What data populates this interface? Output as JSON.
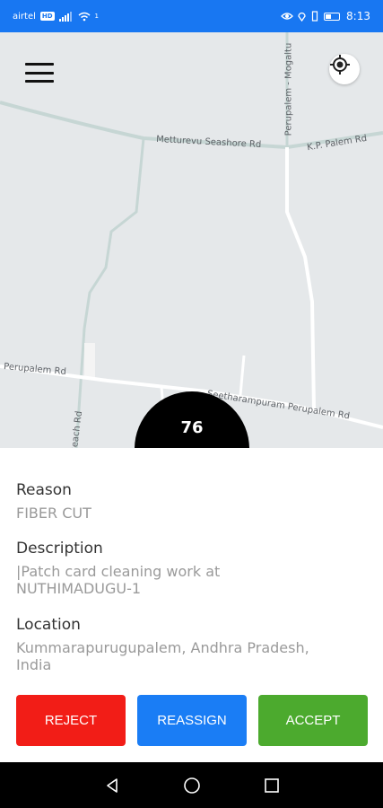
{
  "status_bar": {
    "carrier": "airtel",
    "network_badge": "HD",
    "signal_superscript": "1",
    "time": "8:13"
  },
  "map": {
    "roads": {
      "metturevu": "Metturevu Seashore Rd",
      "kp_palem": "K.P. Palem Rd",
      "perupalem_mogaltu": "Perupalem - Mogaltu",
      "perupalem_rd": "Perupalem Rd",
      "seetharampuram": "Seetharampuram Perupalem Rd",
      "beach_rd": "Beach Rd"
    },
    "count": "76"
  },
  "details": {
    "reason_label": "Reason",
    "reason_value": "FIBER CUT",
    "description_label": "Description",
    "description_line1": "|Patch card cleaning work at",
    "description_line2": "NUTHIMADUGU-1",
    "location_label": "Location",
    "location_line1": "Kummarapurugupalem, Andhra Pradesh,",
    "location_line2": "India"
  },
  "actions": {
    "reject": "REJECT",
    "reassign": "REASSIGN",
    "accept": "ACCEPT"
  },
  "colors": {
    "status_bar": "#1877f2",
    "reject": "#f21d17",
    "reassign": "#1a7df5",
    "accept": "#4caa2e"
  }
}
